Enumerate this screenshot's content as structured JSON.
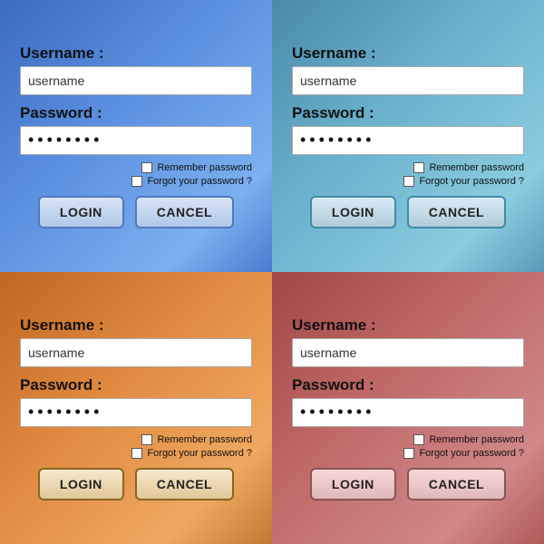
{
  "panels": [
    {
      "id": "blue",
      "class": "panel-blue",
      "username_label": "Username :",
      "username_placeholder": "username",
      "password_label": "Password :",
      "password_dots": "••••••••",
      "remember_label": "Remember password",
      "forgot_label": "Forgot your password ?",
      "login_label": "LOGIN",
      "cancel_label": "CANCEL"
    },
    {
      "id": "teal",
      "class": "panel-teal",
      "username_label": "Username :",
      "username_placeholder": "username",
      "password_label": "Password :",
      "password_dots": "••••••••",
      "remember_label": "Remember password",
      "forgot_label": "Forgot your password ?",
      "login_label": "LOGIN",
      "cancel_label": "CANCEL"
    },
    {
      "id": "orange",
      "class": "panel-orange",
      "username_label": "Username :",
      "username_placeholder": "username",
      "password_label": "Password :",
      "password_dots": "••••••••",
      "remember_label": "Remember password",
      "forgot_label": "Forgot your password ?",
      "login_label": "LOGIN",
      "cancel_label": "CANCEL"
    },
    {
      "id": "rose",
      "class": "panel-rose",
      "username_label": "Username :",
      "username_placeholder": "username",
      "password_label": "Password :",
      "password_dots": "••••••••",
      "remember_label": "Remember password",
      "forgot_label": "Forgot your password ?",
      "login_label": "LOGIN",
      "cancel_label": "CANCEL"
    }
  ]
}
